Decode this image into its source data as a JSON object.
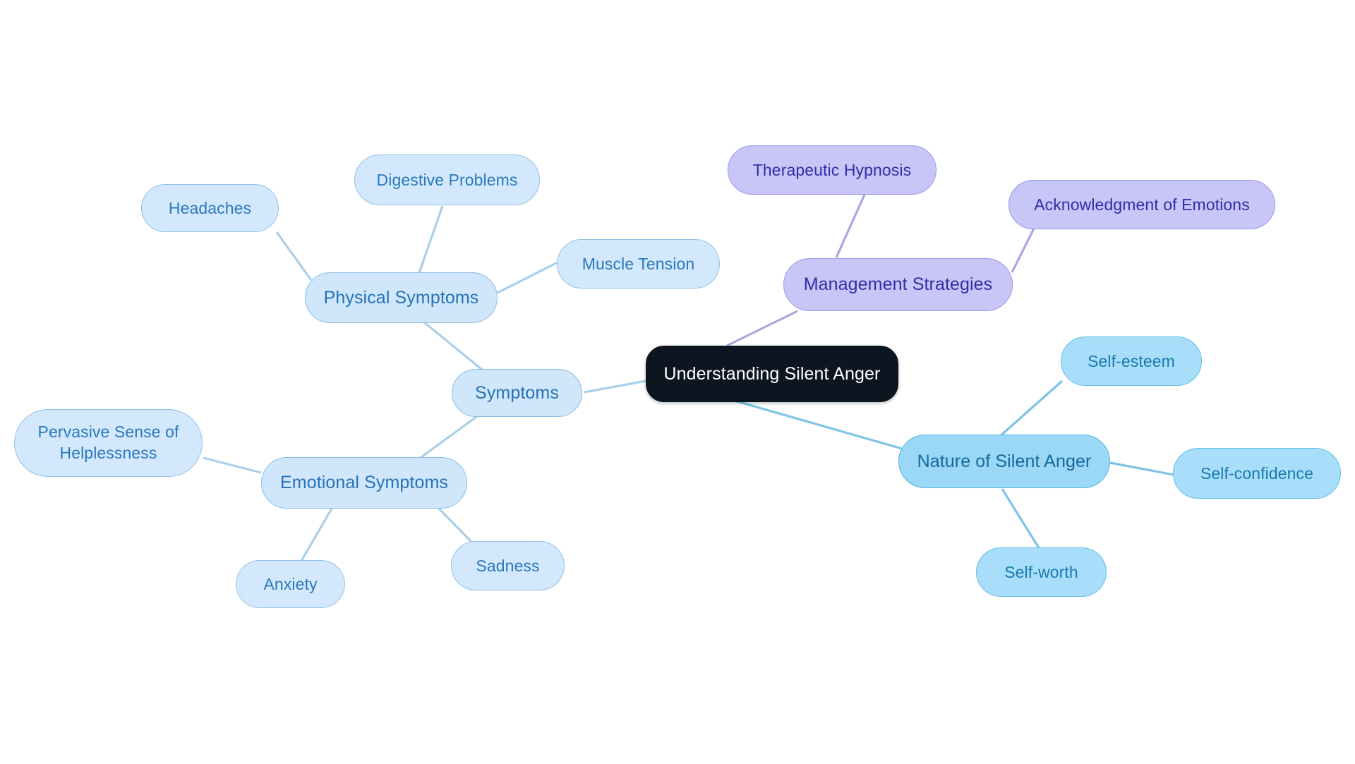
{
  "diagram": {
    "type": "mindmap",
    "title": "Understanding Silent Anger",
    "background_color": "#ffffff",
    "palettes": {
      "root_fill": "#0d1620",
      "root_text": "#ffffff",
      "purple_fill": "#c7c6f7",
      "purple_border": "#9b97e8",
      "purple_text": "#2f2fa8",
      "skyblue_fill": "#9bd8f7",
      "skyblue_border": "#56b4e0",
      "skyblue_text": "#15689a",
      "lightblue_fill": "#cfe6fb",
      "lightblue_border": "#8cbde4",
      "lightblue_text": "#2673b5",
      "edge_blue": "#a9cfe9",
      "edge_purple": "#a9a6e0",
      "edge_sky": "#7dc4e5"
    }
  },
  "nodes": {
    "root": {
      "label": "Understanding Silent Anger"
    },
    "management_strategies": {
      "label": "Management Strategies"
    },
    "therapeutic_hypnosis": {
      "label": "Therapeutic Hypnosis"
    },
    "acknowledgment_of_emotions": {
      "label": "Acknowledgment of Emotions"
    },
    "nature_of_silent_anger": {
      "label": "Nature of Silent Anger"
    },
    "self_esteem": {
      "label": "Self-esteem"
    },
    "self_confidence": {
      "label": "Self-confidence"
    },
    "self_worth": {
      "label": "Self-worth"
    },
    "symptoms": {
      "label": "Symptoms"
    },
    "physical_symptoms": {
      "label": "Physical Symptoms"
    },
    "headaches": {
      "label": "Headaches"
    },
    "digestive_problems": {
      "label": "Digestive Problems"
    },
    "muscle_tension": {
      "label": "Muscle Tension"
    },
    "emotional_symptoms": {
      "label": "Emotional Symptoms"
    },
    "pervasive_sense_of_helplessness": {
      "label": "Pervasive Sense of\nHelplessness"
    },
    "anxiety": {
      "label": "Anxiety"
    },
    "sadness": {
      "label": "Sadness"
    }
  },
  "hierarchy": [
    {
      "id": "root",
      "label": "Understanding Silent Anger",
      "children": [
        {
          "id": "management_strategies",
          "label": "Management Strategies",
          "children": [
            {
              "id": "therapeutic_hypnosis",
              "label": "Therapeutic Hypnosis"
            },
            {
              "id": "acknowledgment_of_emotions",
              "label": "Acknowledgment of Emotions"
            }
          ]
        },
        {
          "id": "nature_of_silent_anger",
          "label": "Nature of Silent Anger",
          "children": [
            {
              "id": "self_esteem",
              "label": "Self-esteem"
            },
            {
              "id": "self_confidence",
              "label": "Self-confidence"
            },
            {
              "id": "self_worth",
              "label": "Self-worth"
            }
          ]
        },
        {
          "id": "symptoms",
          "label": "Symptoms",
          "children": [
            {
              "id": "physical_symptoms",
              "label": "Physical Symptoms",
              "children": [
                {
                  "id": "headaches",
                  "label": "Headaches"
                },
                {
                  "id": "digestive_problems",
                  "label": "Digestive Problems"
                },
                {
                  "id": "muscle_tension",
                  "label": "Muscle Tension"
                }
              ]
            },
            {
              "id": "emotional_symptoms",
              "label": "Emotional Symptoms",
              "children": [
                {
                  "id": "pervasive_sense_of_helplessness",
                  "label": "Pervasive Sense of Helplessness"
                },
                {
                  "id": "anxiety",
                  "label": "Anxiety"
                },
                {
                  "id": "sadness",
                  "label": "Sadness"
                }
              ]
            }
          ]
        }
      ]
    }
  ]
}
